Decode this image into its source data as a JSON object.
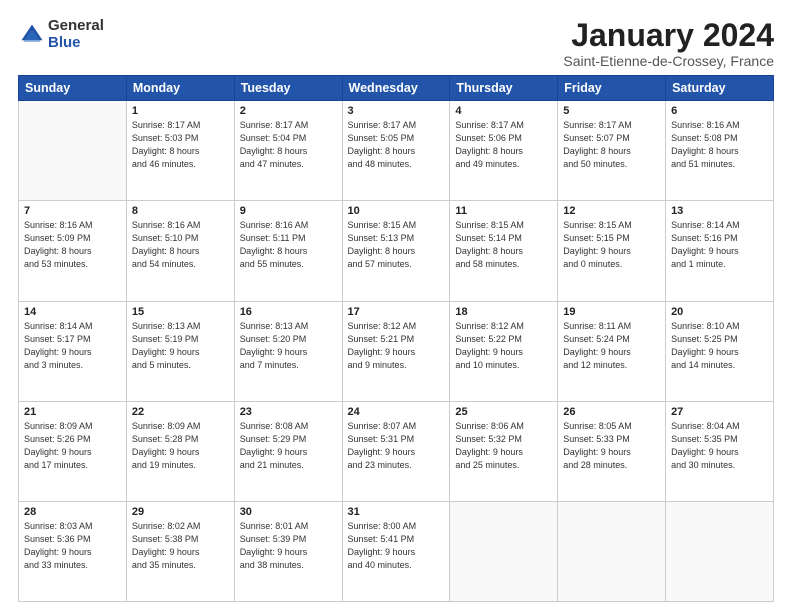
{
  "header": {
    "logo_general": "General",
    "logo_blue": "Blue",
    "month_title": "January 2024",
    "location": "Saint-Etienne-de-Crossey, France"
  },
  "days_of_week": [
    "Sunday",
    "Monday",
    "Tuesday",
    "Wednesday",
    "Thursday",
    "Friday",
    "Saturday"
  ],
  "weeks": [
    [
      {
        "num": "",
        "info": ""
      },
      {
        "num": "1",
        "info": "Sunrise: 8:17 AM\nSunset: 5:03 PM\nDaylight: 8 hours\nand 46 minutes."
      },
      {
        "num": "2",
        "info": "Sunrise: 8:17 AM\nSunset: 5:04 PM\nDaylight: 8 hours\nand 47 minutes."
      },
      {
        "num": "3",
        "info": "Sunrise: 8:17 AM\nSunset: 5:05 PM\nDaylight: 8 hours\nand 48 minutes."
      },
      {
        "num": "4",
        "info": "Sunrise: 8:17 AM\nSunset: 5:06 PM\nDaylight: 8 hours\nand 49 minutes."
      },
      {
        "num": "5",
        "info": "Sunrise: 8:17 AM\nSunset: 5:07 PM\nDaylight: 8 hours\nand 50 minutes."
      },
      {
        "num": "6",
        "info": "Sunrise: 8:16 AM\nSunset: 5:08 PM\nDaylight: 8 hours\nand 51 minutes."
      }
    ],
    [
      {
        "num": "7",
        "info": "Sunrise: 8:16 AM\nSunset: 5:09 PM\nDaylight: 8 hours\nand 53 minutes."
      },
      {
        "num": "8",
        "info": "Sunrise: 8:16 AM\nSunset: 5:10 PM\nDaylight: 8 hours\nand 54 minutes."
      },
      {
        "num": "9",
        "info": "Sunrise: 8:16 AM\nSunset: 5:11 PM\nDaylight: 8 hours\nand 55 minutes."
      },
      {
        "num": "10",
        "info": "Sunrise: 8:15 AM\nSunset: 5:13 PM\nDaylight: 8 hours\nand 57 minutes."
      },
      {
        "num": "11",
        "info": "Sunrise: 8:15 AM\nSunset: 5:14 PM\nDaylight: 8 hours\nand 58 minutes."
      },
      {
        "num": "12",
        "info": "Sunrise: 8:15 AM\nSunset: 5:15 PM\nDaylight: 9 hours\nand 0 minutes."
      },
      {
        "num": "13",
        "info": "Sunrise: 8:14 AM\nSunset: 5:16 PM\nDaylight: 9 hours\nand 1 minute."
      }
    ],
    [
      {
        "num": "14",
        "info": "Sunrise: 8:14 AM\nSunset: 5:17 PM\nDaylight: 9 hours\nand 3 minutes."
      },
      {
        "num": "15",
        "info": "Sunrise: 8:13 AM\nSunset: 5:19 PM\nDaylight: 9 hours\nand 5 minutes."
      },
      {
        "num": "16",
        "info": "Sunrise: 8:13 AM\nSunset: 5:20 PM\nDaylight: 9 hours\nand 7 minutes."
      },
      {
        "num": "17",
        "info": "Sunrise: 8:12 AM\nSunset: 5:21 PM\nDaylight: 9 hours\nand 9 minutes."
      },
      {
        "num": "18",
        "info": "Sunrise: 8:12 AM\nSunset: 5:22 PM\nDaylight: 9 hours\nand 10 minutes."
      },
      {
        "num": "19",
        "info": "Sunrise: 8:11 AM\nSunset: 5:24 PM\nDaylight: 9 hours\nand 12 minutes."
      },
      {
        "num": "20",
        "info": "Sunrise: 8:10 AM\nSunset: 5:25 PM\nDaylight: 9 hours\nand 14 minutes."
      }
    ],
    [
      {
        "num": "21",
        "info": "Sunrise: 8:09 AM\nSunset: 5:26 PM\nDaylight: 9 hours\nand 17 minutes."
      },
      {
        "num": "22",
        "info": "Sunrise: 8:09 AM\nSunset: 5:28 PM\nDaylight: 9 hours\nand 19 minutes."
      },
      {
        "num": "23",
        "info": "Sunrise: 8:08 AM\nSunset: 5:29 PM\nDaylight: 9 hours\nand 21 minutes."
      },
      {
        "num": "24",
        "info": "Sunrise: 8:07 AM\nSunset: 5:31 PM\nDaylight: 9 hours\nand 23 minutes."
      },
      {
        "num": "25",
        "info": "Sunrise: 8:06 AM\nSunset: 5:32 PM\nDaylight: 9 hours\nand 25 minutes."
      },
      {
        "num": "26",
        "info": "Sunrise: 8:05 AM\nSunset: 5:33 PM\nDaylight: 9 hours\nand 28 minutes."
      },
      {
        "num": "27",
        "info": "Sunrise: 8:04 AM\nSunset: 5:35 PM\nDaylight: 9 hours\nand 30 minutes."
      }
    ],
    [
      {
        "num": "28",
        "info": "Sunrise: 8:03 AM\nSunset: 5:36 PM\nDaylight: 9 hours\nand 33 minutes."
      },
      {
        "num": "29",
        "info": "Sunrise: 8:02 AM\nSunset: 5:38 PM\nDaylight: 9 hours\nand 35 minutes."
      },
      {
        "num": "30",
        "info": "Sunrise: 8:01 AM\nSunset: 5:39 PM\nDaylight: 9 hours\nand 38 minutes."
      },
      {
        "num": "31",
        "info": "Sunrise: 8:00 AM\nSunset: 5:41 PM\nDaylight: 9 hours\nand 40 minutes."
      },
      {
        "num": "",
        "info": ""
      },
      {
        "num": "",
        "info": ""
      },
      {
        "num": "",
        "info": ""
      }
    ]
  ]
}
